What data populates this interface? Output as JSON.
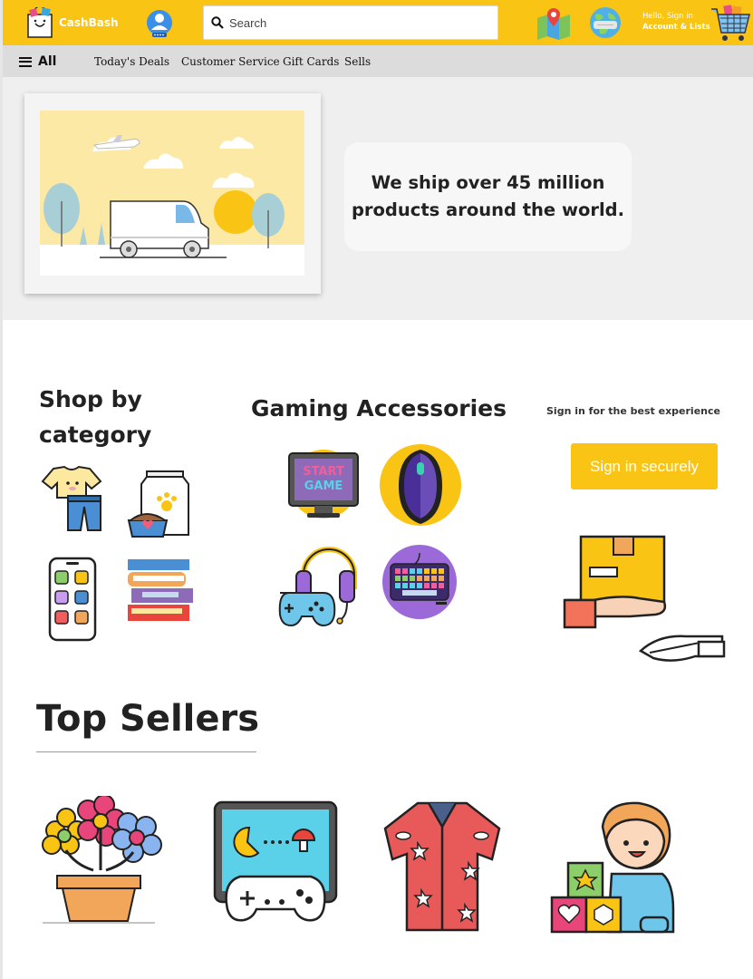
{
  "header": {
    "brand": "CashBash",
    "search_placeholder": "Search",
    "account_line1": "Hello, Sign in",
    "account_line2": "Account & Lists"
  },
  "nav": {
    "all_label": "All",
    "links": [
      "Today's Deals",
      "Customer Service",
      "Gift Cards",
      "Sells"
    ]
  },
  "hero": {
    "line1": "We ship over 45 million",
    "line2": "products around the world."
  },
  "shop_by_category": {
    "title": "Shop by category",
    "items": [
      "clothing-icon",
      "pet-food-icon",
      "smartphone-icon",
      "books-icon"
    ]
  },
  "gaming": {
    "title": "Gaming Accessories",
    "items": [
      "start-game-monitor-icon",
      "gaming-mouse-icon",
      "headset-controller-icon",
      "keyboard-icon"
    ],
    "monitor_text_1": "START",
    "monitor_text_2": "GAME"
  },
  "signin": {
    "prompt": "Sign in for the best experience",
    "button": "Sign in securely"
  },
  "top_sellers": {
    "title": "Top Sellers",
    "items": [
      "flower-pot-icon",
      "game-console-icon",
      "hawaiian-shirt-icon",
      "child-blocks-icon"
    ]
  },
  "colors": {
    "brand_yellow": "#f9c413",
    "nav_gray": "#dcdcdc",
    "hero_gray": "#efefef"
  }
}
